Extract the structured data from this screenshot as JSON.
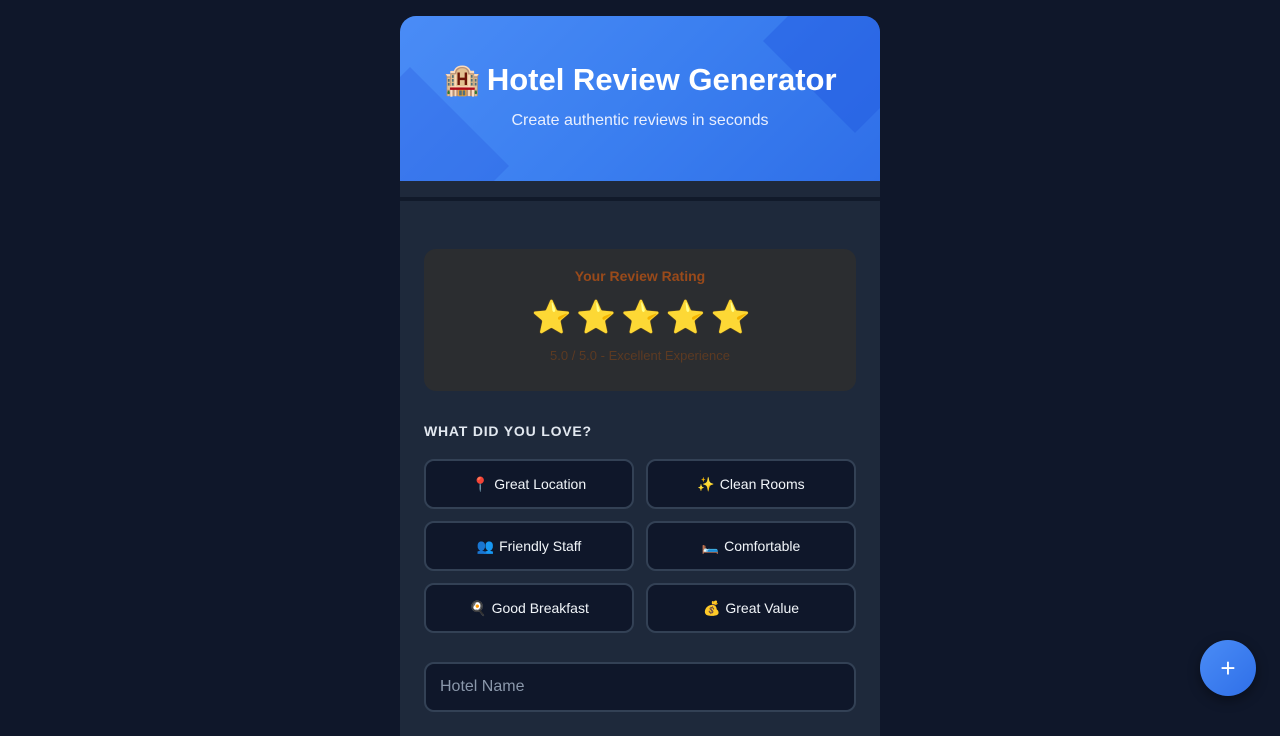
{
  "header": {
    "icon": "🏨",
    "title": "Hotel Review Generator",
    "subtitle": "Create authentic reviews in seconds",
    "gradient": [
      "#4a8cf6",
      "#2f6fe8"
    ]
  },
  "rating": {
    "label": "Your Review Rating",
    "value": 5.0,
    "max": 5,
    "stars": [
      "⭐",
      "⭐",
      "⭐",
      "⭐",
      "⭐"
    ],
    "note": "5.0 / 5.0 - Excellent Experience"
  },
  "features": {
    "label": "WHAT DID YOU LOVE?",
    "items": [
      {
        "icon": "📍",
        "icon_name": "pin-icon",
        "label": "Great Location"
      },
      {
        "icon": "✨",
        "icon_name": "sparkles-icon",
        "label": "Clean Rooms"
      },
      {
        "icon": "👥",
        "icon_name": "people-icon",
        "label": "Friendly Staff"
      },
      {
        "icon": "🛏️",
        "icon_name": "bed-icon",
        "label": "Comfortable"
      },
      {
        "icon": "🍳",
        "icon_name": "breakfast-icon",
        "label": "Good Breakfast"
      },
      {
        "icon": "💰",
        "icon_name": "money-bag-icon",
        "label": "Great Value"
      }
    ]
  },
  "hotel_name": {
    "placeholder": "Hotel Name",
    "value": ""
  },
  "fab": {
    "label": "+",
    "icon_name": "plus-icon"
  },
  "colors": {
    "background": "#0f172a",
    "card": "#1e293b",
    "accent": "#3b82f6",
    "star": "#f6c21b"
  }
}
